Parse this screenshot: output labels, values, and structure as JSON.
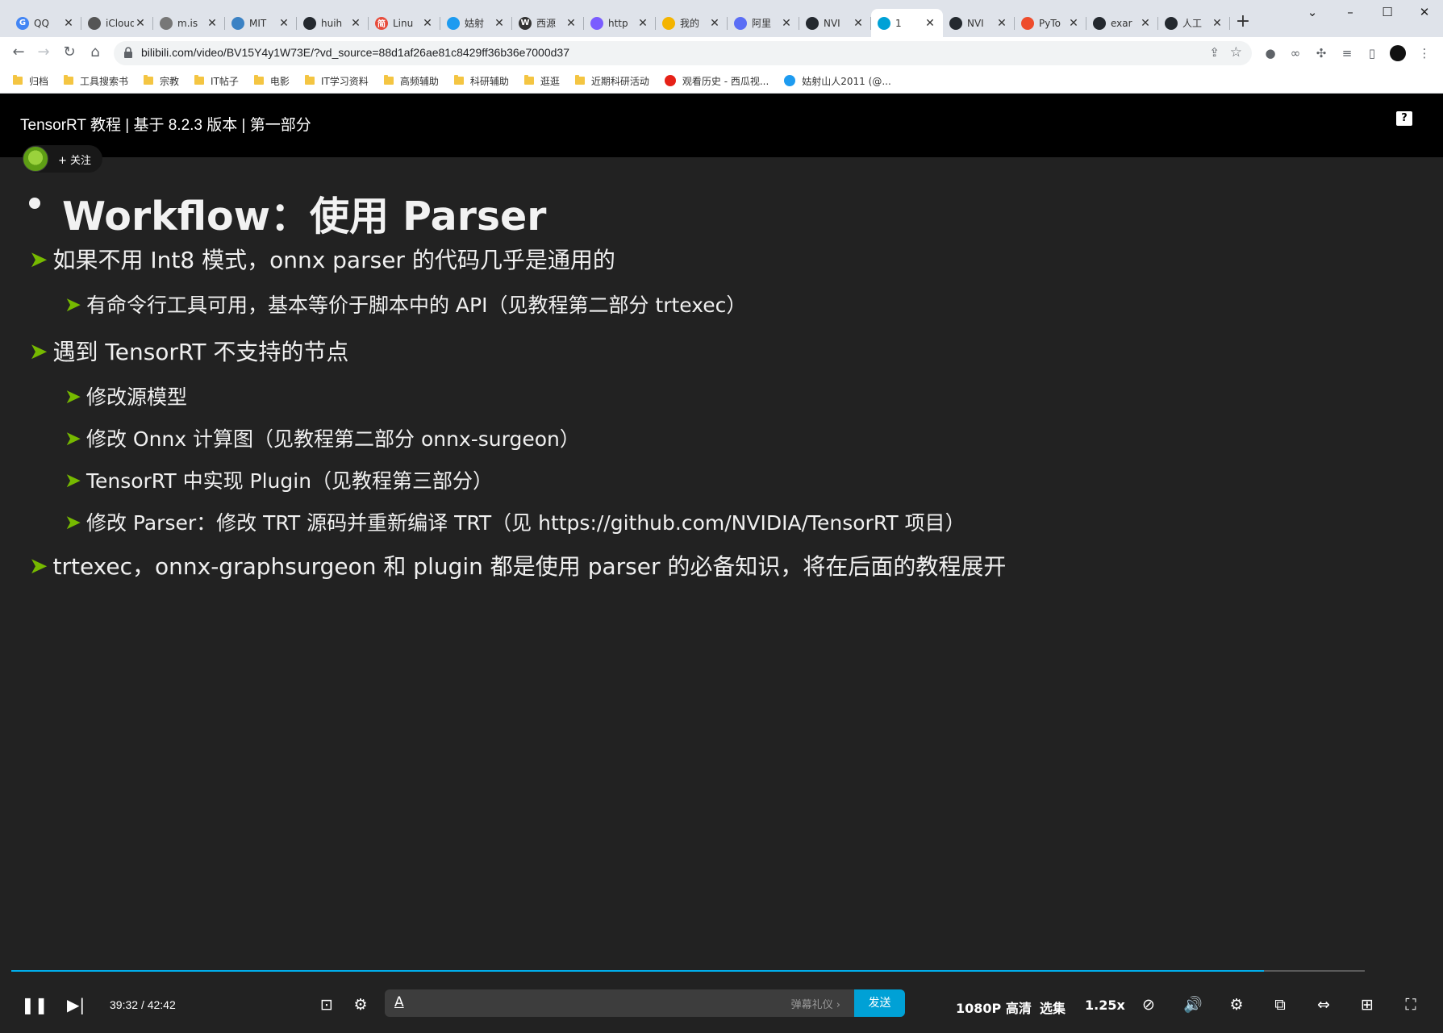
{
  "browser": {
    "tabs": [
      {
        "title": "QQ",
        "favicon_color": "#4285f4",
        "glyph": "G"
      },
      {
        "title": "iCloud",
        "favicon_color": "#555555",
        "glyph": ""
      },
      {
        "title": "m.is",
        "favicon_color": "#777777",
        "glyph": ""
      },
      {
        "title": "MIT",
        "favicon_color": "#3b82c4",
        "glyph": ""
      },
      {
        "title": "huih",
        "favicon_color": "#24292f",
        "glyph": ""
      },
      {
        "title": "Linu",
        "favicon_color": "#e74c3c",
        "glyph": "简"
      },
      {
        "title": "姑射",
        "favicon_color": "#1d9bf0",
        "glyph": ""
      },
      {
        "title": "西源",
        "favicon_color": "#333333",
        "glyph": "W"
      },
      {
        "title": "http",
        "favicon_color": "#7a5cff",
        "glyph": ""
      },
      {
        "title": "我的",
        "favicon_color": "#f4b400",
        "glyph": ""
      },
      {
        "title": "阿里",
        "favicon_color": "#5b6ef5",
        "glyph": ""
      },
      {
        "title": "NVI",
        "favicon_color": "#24292f",
        "glyph": ""
      },
      {
        "title": "1",
        "favicon_color": "#00a1d6",
        "glyph": ""
      },
      {
        "title": "NVI",
        "favicon_color": "#24292f",
        "glyph": ""
      },
      {
        "title": "PyTo",
        "favicon_color": "#ee4c2c",
        "glyph": ""
      },
      {
        "title": "exar",
        "favicon_color": "#24292f",
        "glyph": ""
      },
      {
        "title": "人工",
        "favicon_color": "#24292f",
        "glyph": ""
      }
    ],
    "active_tab_index": 12,
    "new_tab_label": "+",
    "url": "bilibili.com/video/BV15Y4y1W73E/?vd_source=88d1af26ae81c8429ff36b36e7000d37",
    "bookmarks": [
      {
        "label": "归档",
        "type": "folder"
      },
      {
        "label": "工具搜索书",
        "type": "folder"
      },
      {
        "label": "宗教",
        "type": "folder"
      },
      {
        "label": "IT帖子",
        "type": "folder"
      },
      {
        "label": "电影",
        "type": "folder"
      },
      {
        "label": "IT学习资料",
        "type": "folder"
      },
      {
        "label": "高频辅助",
        "type": "folder"
      },
      {
        "label": "科研辅助",
        "type": "folder"
      },
      {
        "label": "逛逛",
        "type": "folder"
      },
      {
        "label": "近期科研活动",
        "type": "folder"
      },
      {
        "label": "观看历史 - 西瓜视...",
        "type": "link",
        "color": "#e62117"
      },
      {
        "label": "姑射山人2011 (@...",
        "type": "link",
        "color": "#1d9bf0"
      }
    ]
  },
  "video": {
    "title": "TensorRT 教程 | 基于 8.2.3 版本 | 第一部分",
    "help_label": "?",
    "follow_label": "+ 关注",
    "slide": {
      "heading": "Workflow：使用 Parser",
      "items": [
        {
          "level": 1,
          "text": "如果不用 Int8 模式，onnx parser 的代码几乎是通用的"
        },
        {
          "level": 2,
          "text": "有命令行工具可用，基本等价于脚本中的 API（见教程第二部分 trtexec）"
        },
        {
          "level": 1,
          "text": "遇到 TensorRT 不支持的节点"
        },
        {
          "level": 2,
          "text": "修改源模型"
        },
        {
          "level": 2,
          "text": "修改 Onnx 计算图（见教程第二部分 onnx-surgeon）"
        },
        {
          "level": 2,
          "text": "TensorRT 中实现 Plugin（见教程第三部分）"
        },
        {
          "level": 2,
          "text": "修改 Parser：修改 TRT 源码并重新编译 TRT（见 https://github.com/NVIDIA/TensorRT 项目）"
        },
        {
          "level": 1,
          "text": "trtexec，onnx-graphsurgeon 和 plugin 都是使用 parser 的必备知识，将在后面的教程展开"
        }
      ]
    },
    "player": {
      "current_time": "39:32",
      "separator": "/",
      "duration": "42:42",
      "progress_fraction": 0.9257,
      "danmaku_etiquette": "弹幕礼仪 ›",
      "send_label": "发送",
      "quality": "1080P 高清",
      "episodes": "选集",
      "speed": "1.25x"
    }
  },
  "colors": {
    "accent": "#00a1d6",
    "bullet_arrow": "#76b900",
    "slide_bg": "#222222"
  }
}
